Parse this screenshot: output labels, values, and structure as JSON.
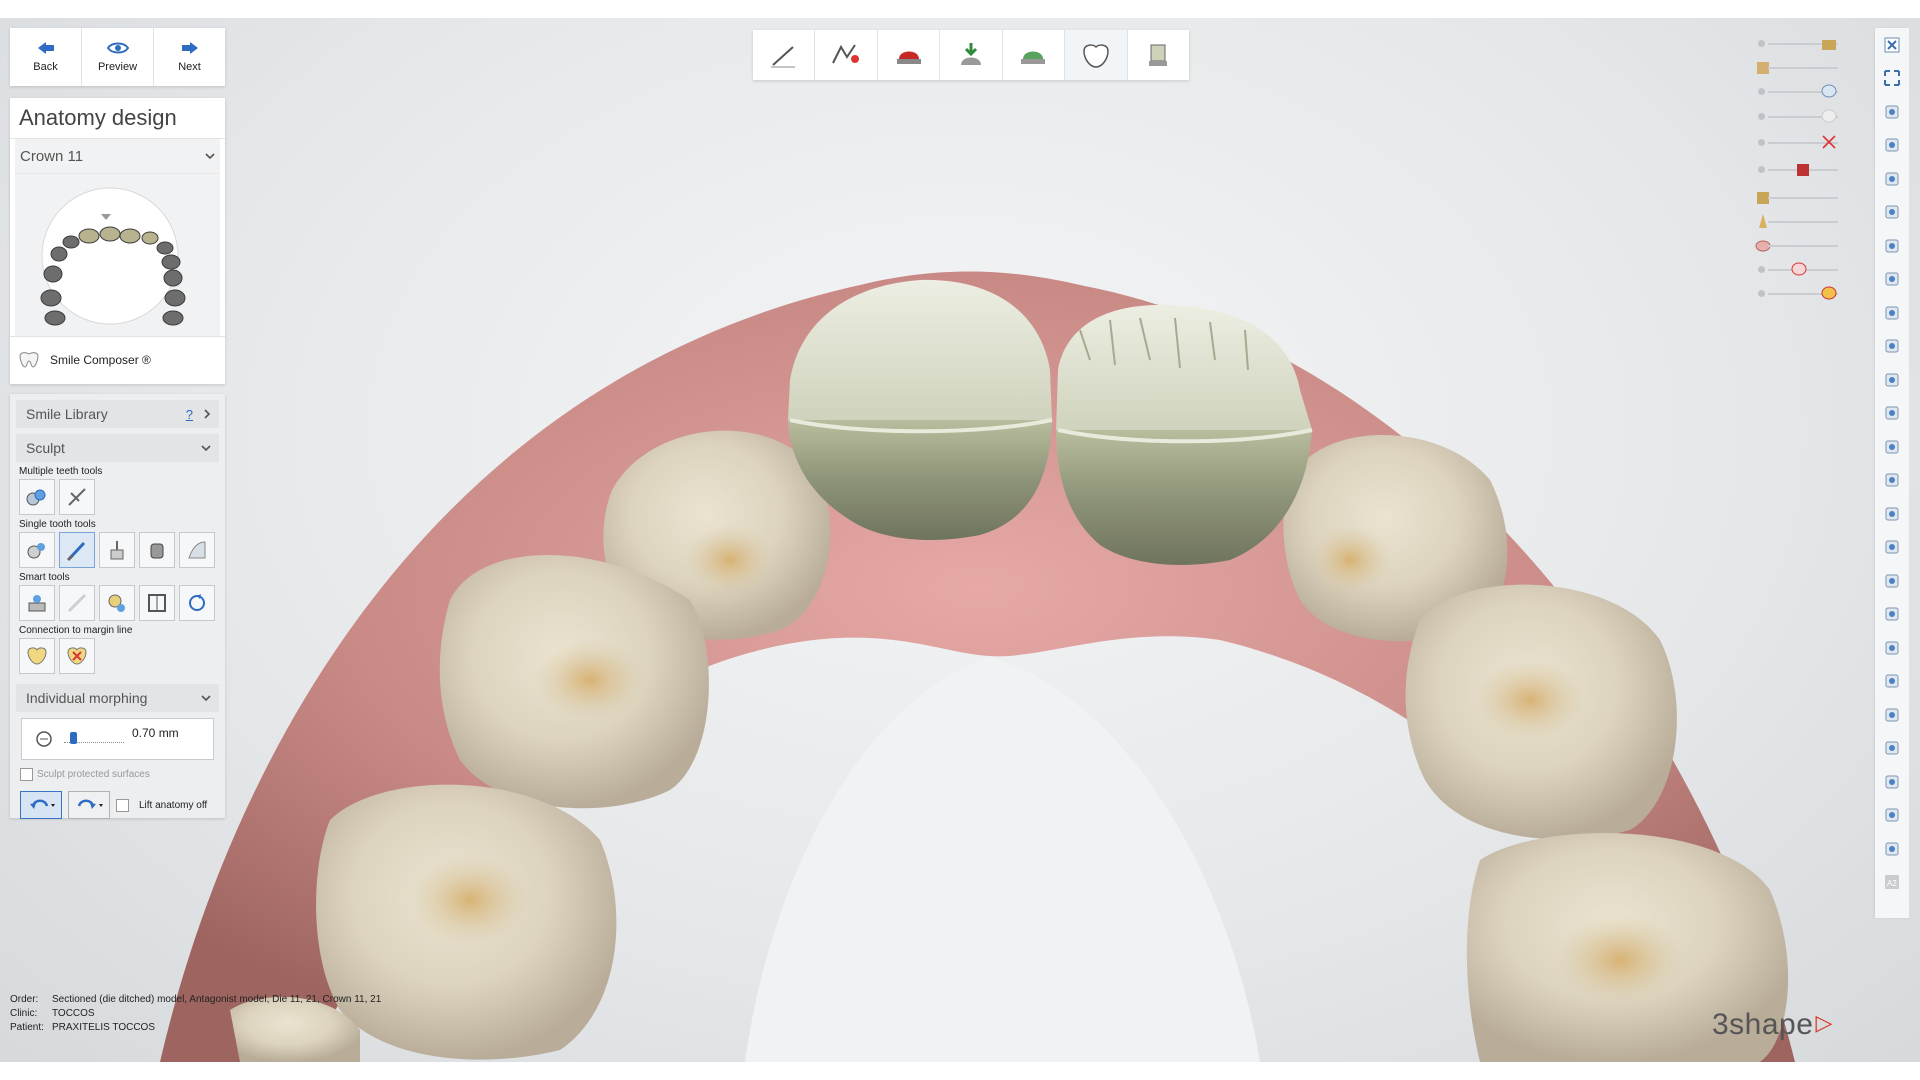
{
  "app": {
    "name": "3Shape Dental System",
    "brand_logo_text": "3shape"
  },
  "colors": {
    "accent_blue": "#2d6cc0",
    "gum_pink": "#c98b8b",
    "crown_green": "#c7cbb0",
    "logo_red": "#d9361e"
  },
  "nav": {
    "back_label": "Back",
    "preview_label": "Preview",
    "next_label": "Next"
  },
  "panel": {
    "title": "Anatomy design",
    "crown_select": "Crown 11",
    "smile_composer_label": "Smile Composer ®"
  },
  "tools": {
    "smile_library_label": "Smile Library",
    "smile_library_help": "?",
    "sculpt_label": "Sculpt",
    "multiple_teeth_label": "Multiple teeth tools",
    "single_tooth_label": "Single tooth tools",
    "smart_tools_label": "Smart tools",
    "connection_label": "Connection to margin line",
    "individual_morphing_label": "Individual morphing",
    "morph_value": "0.70 mm",
    "morph_level": 0.12,
    "sculpt_protected_label": "Sculpt protected surfaces",
    "lift_anatomy_label": "Lift anatomy off"
  },
  "workflow_steps": [
    {
      "icon": "margin-line-icon"
    },
    {
      "icon": "die-preparation-icon"
    },
    {
      "icon": "crown-coping-icon"
    },
    {
      "icon": "insertion-direction-icon"
    },
    {
      "icon": "cement-gap-icon"
    },
    {
      "icon": "anatomy-design-icon",
      "current": true
    },
    {
      "icon": "post-processing-icon"
    }
  ],
  "right_tools": [
    "close-icon",
    "fullscreen-icon",
    "view-rotate-icon",
    "graduate-cap-icon",
    "view-front-icon",
    "view-left-icon",
    "view-right-icon",
    "view-top-icon",
    "pen-tool-icon",
    "pencil-tool-icon",
    "zoom-tooth-icon",
    "rotate-tooth-icon",
    "flask-icon",
    "ruler-icon",
    "cup-icon",
    "face-icon",
    "warning-icon",
    "checkbox-icon",
    "camera-icon",
    "sphere-icon",
    "cube-icon",
    "cross-section-icon",
    "measure-icon",
    "print-icon",
    "color-wheel-icon",
    "a2-shade-icon"
  ],
  "footer": {
    "order_key": "Order:",
    "order_value": "Sectioned (die ditched) model, Antagonist model, Die 11, 21, Crown 11, 21",
    "clinic_key": "Clinic:",
    "clinic_value": "TOCCOS",
    "patient_key": "Patient:",
    "patient_value": "PRAXITELIS TOCCOS"
  }
}
